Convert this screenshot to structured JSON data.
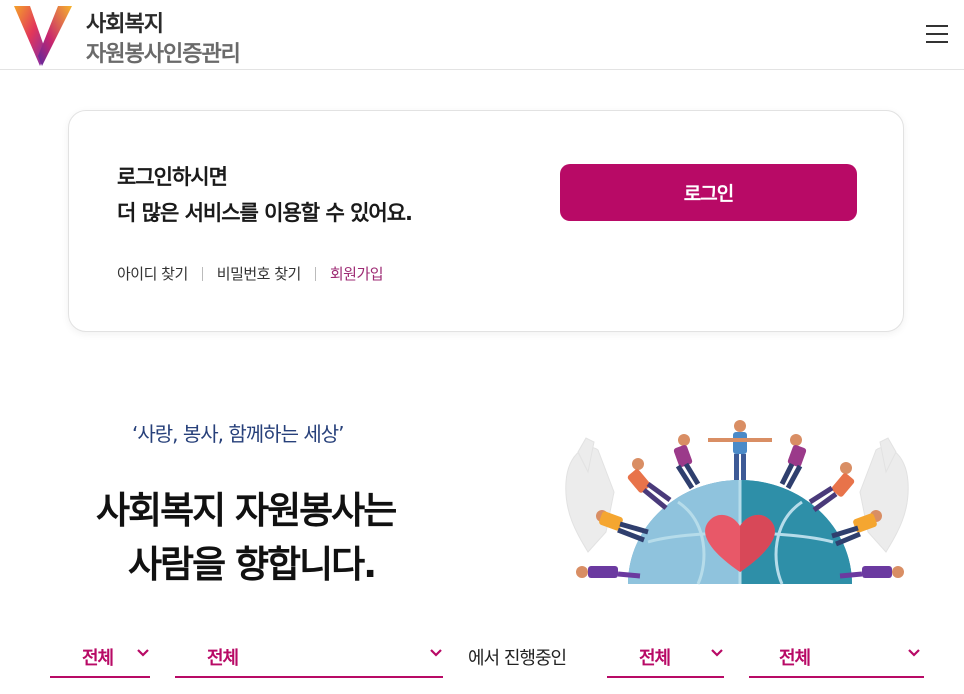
{
  "header": {
    "brand_line1": "사회복지",
    "brand_line2": "자원봉사인증관리",
    "logo_icon": "v-logo-icon",
    "menu_icon": "hamburger-menu-icon"
  },
  "login": {
    "message_line1": "로그인하시면",
    "message_line2": "더 많은 서비스를 이용할 수 있어요.",
    "button_label": "로그인",
    "links": {
      "find_id": "아이디 찾기",
      "find_password": "비밀번호 찾기",
      "signup": "회원가입"
    }
  },
  "hero": {
    "quote": "‘사랑, 봉사, 함께하는 세상’",
    "title_line1": "사회복지 자원봉사는",
    "title_line2": "사람을 향합니다.",
    "illustration": "volunteers-around-globe-with-heart"
  },
  "filters": {
    "region1": "전체",
    "region2": "전체",
    "connector": "에서 진행중인",
    "category1": "전체",
    "category2": "전체"
  },
  "colors": {
    "accent": "#b80a66",
    "quote": "#27407a"
  }
}
